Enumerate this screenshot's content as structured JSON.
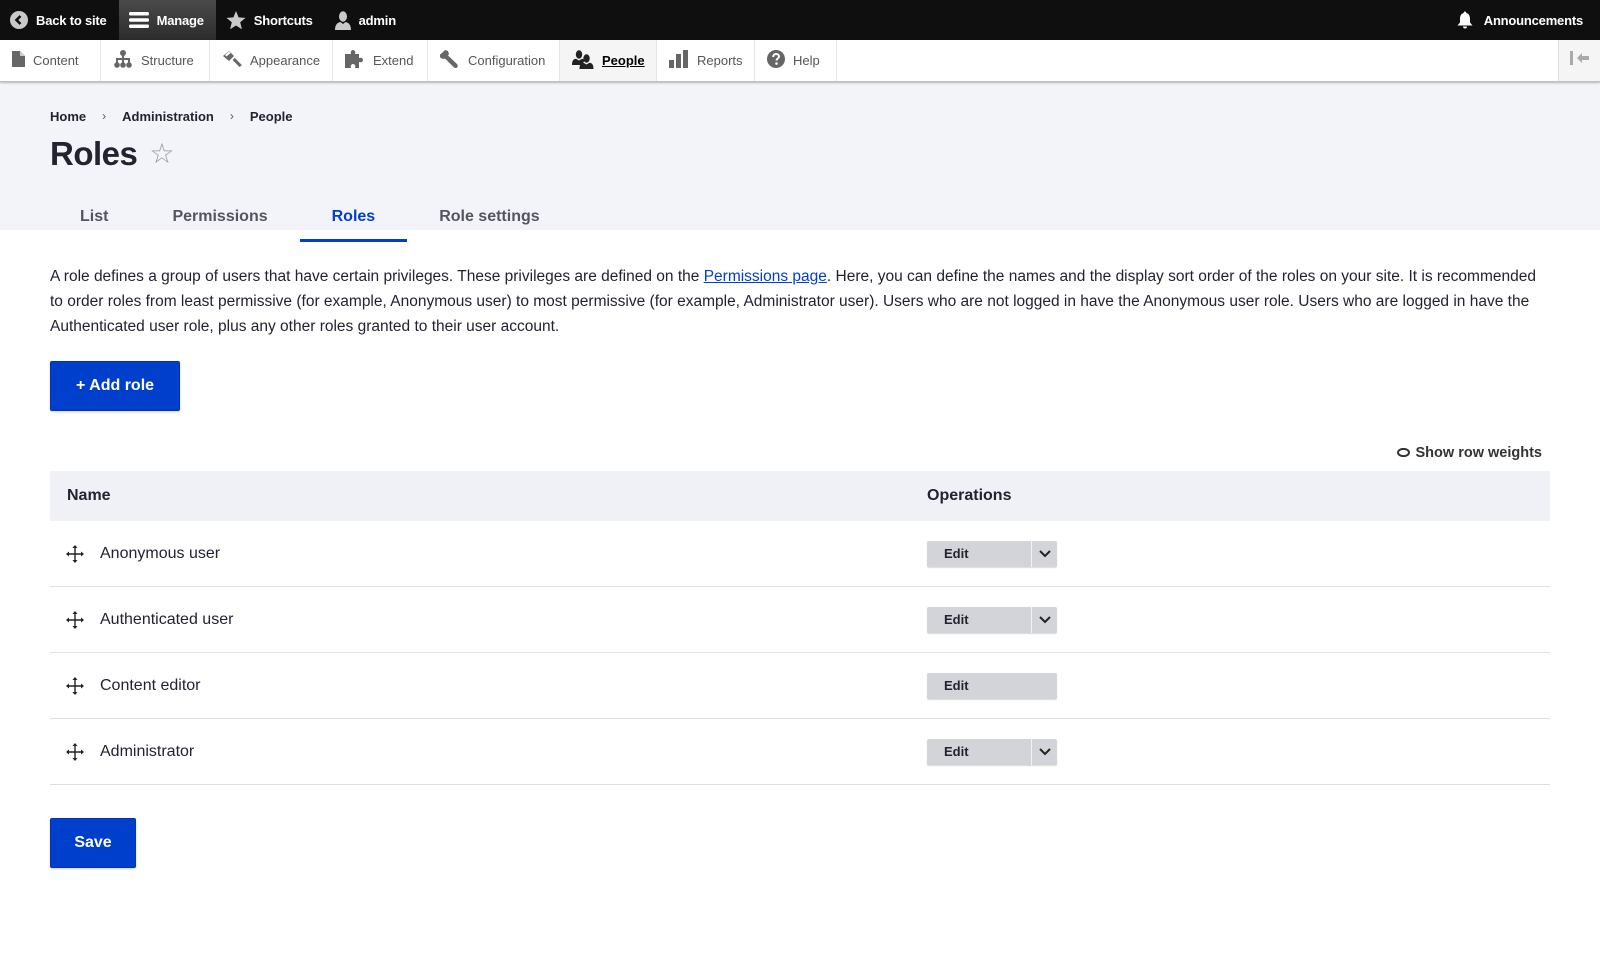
{
  "toolbar": {
    "back_to_site": "Back to site",
    "manage": "Manage",
    "shortcuts": "Shortcuts",
    "user": "admin",
    "announcements": "Announcements"
  },
  "tray": {
    "items": [
      {
        "label": "Content",
        "icon": "file-icon"
      },
      {
        "label": "Structure",
        "icon": "sitemap-icon"
      },
      {
        "label": "Appearance",
        "icon": "paintbrush-icon"
      },
      {
        "label": "Extend",
        "icon": "puzzle-icon"
      },
      {
        "label": "Configuration",
        "icon": "wrench-icon"
      },
      {
        "label": "People",
        "icon": "people-icon",
        "active": true
      },
      {
        "label": "Reports",
        "icon": "bar-chart-icon"
      },
      {
        "label": "Help",
        "icon": "help-icon"
      }
    ]
  },
  "breadcrumb": [
    "Home",
    "Administration",
    "People"
  ],
  "page": {
    "title": "Roles",
    "star": "☆"
  },
  "tabs": [
    {
      "label": "List"
    },
    {
      "label": "Permissions"
    },
    {
      "label": "Roles",
      "active": true
    },
    {
      "label": "Role settings"
    }
  ],
  "description": {
    "before_link": "A role defines a group of users that have certain privileges. These privileges are defined on the ",
    "link": "Permissions page",
    "after_link": ". Here, you can define the names and the display sort order of the roles on your site. It is recommended to order roles from least permissive (for example, Anonymous user) to most permissive (for example, Administrator user). Users who are not logged in have the Anonymous user role. Users who are logged in have the Authenticated user role, plus any other roles granted to their user account."
  },
  "add_role": "+ Add role",
  "show_row_weights": "Show row weights",
  "table": {
    "headers": {
      "name": "Name",
      "operations": "Operations"
    },
    "rows": [
      {
        "name": "Anonymous user",
        "operation": "Edit",
        "has_dropdown": true
      },
      {
        "name": "Authenticated user",
        "operation": "Edit",
        "has_dropdown": true
      },
      {
        "name": "Content editor",
        "operation": "Edit",
        "has_dropdown": false
      },
      {
        "name": "Administrator",
        "operation": "Edit",
        "has_dropdown": true
      }
    ]
  },
  "save": "Save",
  "colors": {
    "accent": "#003ecc",
    "toolbar_bg": "#0f0f0f",
    "header_bg": "#f3f4f9"
  }
}
